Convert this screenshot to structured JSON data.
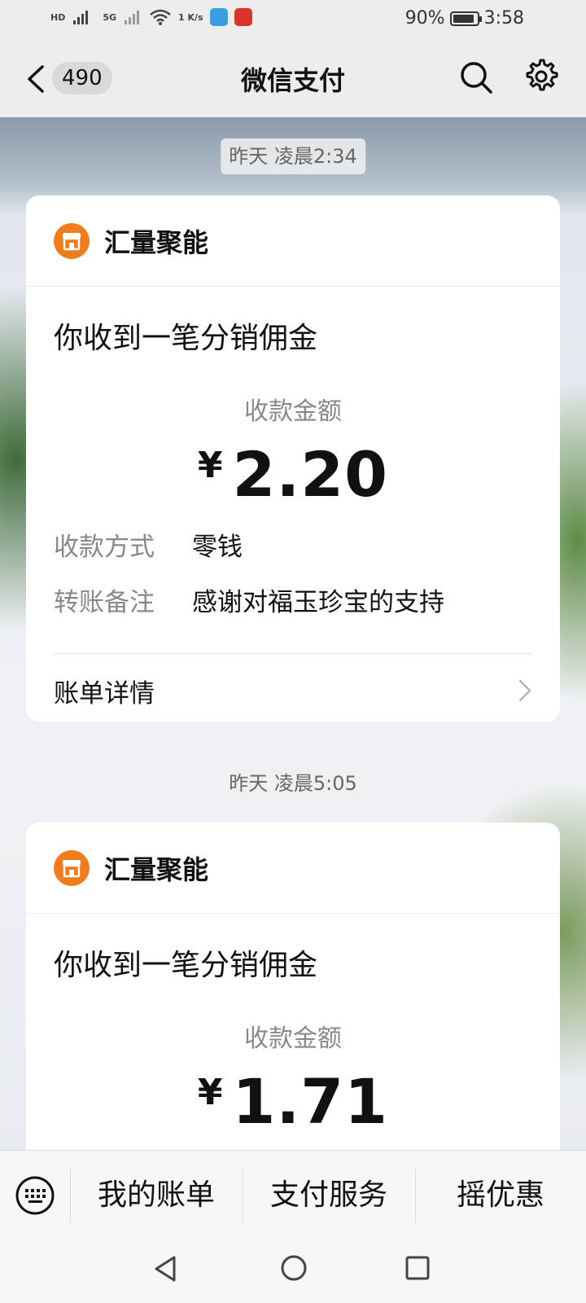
{
  "status_bar": {
    "left_items": [
      "HD",
      "5G",
      "1 K/s"
    ],
    "battery_percent": "90%",
    "battery_level": 0.9,
    "time": "3:58"
  },
  "navbar": {
    "back_badge": "490",
    "title": "微信支付",
    "icons": [
      "chevron-left-icon",
      "search-icon",
      "gear-icon"
    ]
  },
  "messages": [
    {
      "timestamp": "昨天 凌晨2:34",
      "merchant": "汇量聚能",
      "title": "你收到一笔分销佣金",
      "amount_label": "收款金额",
      "currency": "¥",
      "amount": "2.20",
      "rows": [
        {
          "key": "收款方式",
          "value": "零钱"
        },
        {
          "key": "转账备注",
          "value": "感谢对福玉珍宝的支持"
        }
      ],
      "detail_label": "账单详情"
    },
    {
      "timestamp": "昨天 凌晨5:05",
      "merchant": "汇量聚能",
      "title": "你收到一笔分销佣金",
      "amount_label": "收款金额",
      "currency": "¥",
      "amount": "1.71"
    }
  ],
  "bottom_menu": {
    "items": [
      "我的账单",
      "支付服务",
      "摇优惠"
    ]
  },
  "colors": {
    "merchant_icon": "#f07c1e",
    "background": "#ededed"
  }
}
